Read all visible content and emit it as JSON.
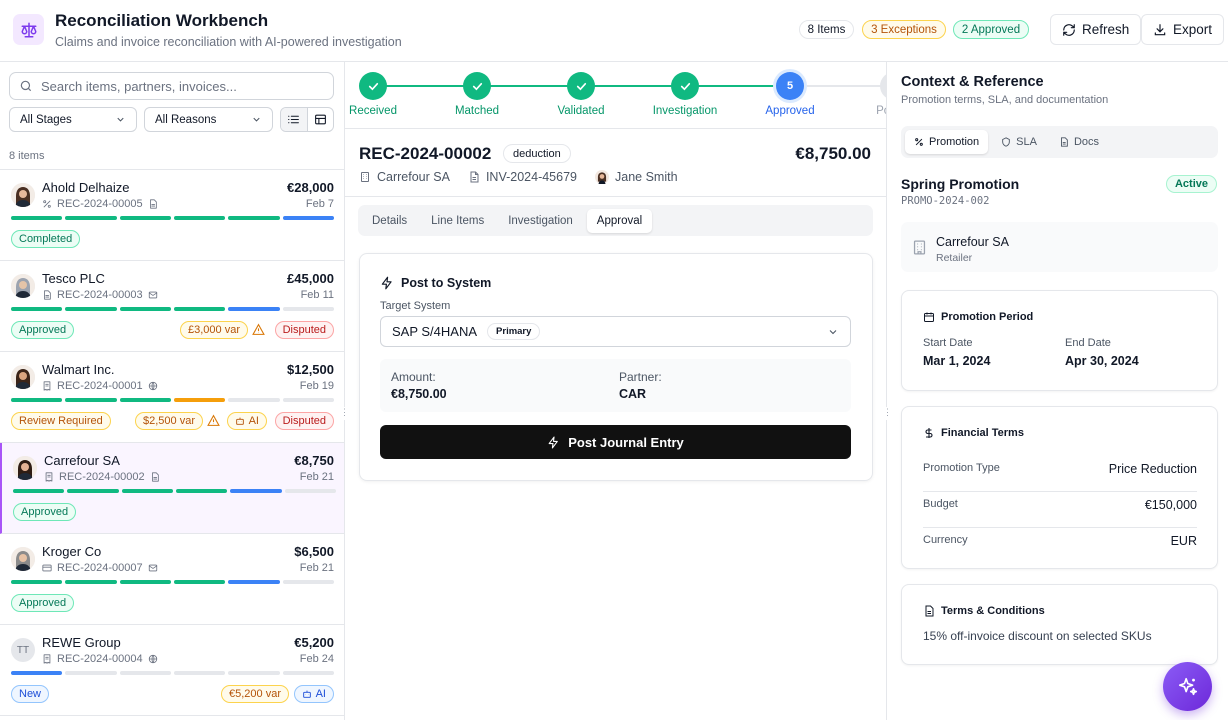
{
  "app": {
    "title": "Reconciliation Workbench",
    "subtitle": "Claims and invoice reconciliation with AI-powered investigation",
    "badges": {
      "items": "8 Items",
      "exceptions": "3 Exceptions",
      "approved": "2 Approved"
    },
    "refresh_label": "Refresh",
    "export_label": "Export"
  },
  "filters": {
    "search_placeholder": "Search items, partners, invoices...",
    "stage": "All Stages",
    "reason": "All Reasons",
    "count_label": "8 items"
  },
  "items": [
    {
      "name": "Ahold Delhaize",
      "amount": "€28,000",
      "ref": "REC-2024-00005",
      "date": "Feb 7",
      "type_icon": "percent-icon",
      "channel_icon": "document-icon",
      "avatar": "photo",
      "bars": [
        "green",
        "green",
        "green",
        "green",
        "green",
        "blue"
      ],
      "status": "Completed",
      "status_color": "green",
      "var": "",
      "flag": "",
      "ai": ""
    },
    {
      "name": "Tesco PLC",
      "amount": "£45,000",
      "ref": "REC-2024-00003",
      "date": "Feb 11",
      "type_icon": "document-icon",
      "channel_icon": "mail-icon",
      "avatar": "photo",
      "bars": [
        "green",
        "green",
        "green",
        "green",
        "blue",
        "gray"
      ],
      "status": "Approved",
      "status_color": "green",
      "var": "£3,000 var",
      "flag": "Disputed",
      "ai": ""
    },
    {
      "name": "Walmart Inc.",
      "amount": "$12,500",
      "ref": "REC-2024-00001",
      "date": "Feb 19",
      "type_icon": "receipt-icon",
      "channel_icon": "globe-icon",
      "avatar": "photo",
      "bars": [
        "green",
        "green",
        "green",
        "orange",
        "gray",
        "gray"
      ],
      "status": "Review Required",
      "status_color": "orange",
      "var": "$2,500 var",
      "flag": "Disputed",
      "ai": "AI"
    },
    {
      "name": "Carrefour SA",
      "amount": "€8,750",
      "ref": "REC-2024-00002",
      "date": "Feb 21",
      "type_icon": "receipt-icon",
      "channel_icon": "document-icon",
      "avatar": "photo",
      "bars": [
        "green",
        "green",
        "green",
        "green",
        "blue",
        "gray"
      ],
      "status": "Approved",
      "status_color": "green",
      "var": "",
      "flag": "",
      "ai": ""
    },
    {
      "name": "Kroger Co",
      "amount": "$6,500",
      "ref": "REC-2024-00007",
      "date": "Feb 21",
      "type_icon": "card-icon",
      "channel_icon": "mail-icon",
      "avatar": "photo",
      "bars": [
        "green",
        "green",
        "green",
        "green",
        "blue",
        "gray"
      ],
      "status": "Approved",
      "status_color": "green",
      "var": "",
      "flag": "",
      "ai": ""
    },
    {
      "name": "REWE Group",
      "amount": "€5,200",
      "ref": "REC-2024-00004",
      "date": "Feb 24",
      "type_icon": "receipt-icon",
      "channel_icon": "globe-icon",
      "avatar": "TT",
      "bars": [
        "blue",
        "gray",
        "gray",
        "gray",
        "gray",
        "gray"
      ],
      "status": "New",
      "status_color": "blue",
      "var": "€5,200 var",
      "flag": "",
      "ai": "AI"
    }
  ],
  "stepper": {
    "steps": [
      {
        "label": "Received",
        "state": "done"
      },
      {
        "label": "Matched",
        "state": "done"
      },
      {
        "label": "Validated",
        "state": "done"
      },
      {
        "label": "Investigation",
        "state": "done"
      },
      {
        "label": "Approved",
        "state": "current",
        "number": "5"
      },
      {
        "label": "Posted",
        "state": "todo"
      }
    ]
  },
  "record": {
    "id": "REC-2024-00002",
    "type": "deduction",
    "amount": "€8,750.00",
    "partner": "Carrefour SA",
    "invoice": "INV-2024-45679",
    "owner": "Jane Smith",
    "tabs": [
      "Details",
      "Line Items",
      "Investigation",
      "Approval"
    ],
    "active_tab": "Approval"
  },
  "post": {
    "title": "Post to System",
    "target_label": "Target System",
    "target_value": "SAP S/4HANA",
    "target_tag": "Primary",
    "amount_label": "Amount:",
    "amount_value": "€8,750.00",
    "partner_label": "Partner:",
    "partner_value": "CAR",
    "button": "Post Journal Entry"
  },
  "context": {
    "title": "Context & Reference",
    "subtitle": "Promotion terms, SLA, and documentation",
    "tabs": [
      "Promotion",
      "SLA",
      "Docs"
    ],
    "promotion": {
      "name": "Spring Promotion",
      "id": "PROMO-2024-002",
      "status": "Active",
      "retailer": "Carrefour SA",
      "retailer_role": "Retailer",
      "period_title": "Promotion Period",
      "start_label": "Start Date",
      "start": "Mar 1, 2024",
      "end_label": "End Date",
      "end": "Apr 30, 2024",
      "financial_title": "Financial Terms",
      "financial": [
        {
          "k": "Promotion Type",
          "v": "Price Reduction"
        },
        {
          "k": "Budget",
          "v": "€150,000"
        },
        {
          "k": "Currency",
          "v": "EUR"
        }
      ],
      "terms_title": "Terms & Conditions",
      "terms": "15% off-invoice discount on selected SKUs"
    }
  },
  "colors": {
    "green": "#10b981",
    "blue": "#3b82f6",
    "orange": "#f59e0b",
    "gray": "#e5e7eb",
    "purple": "#7c3aed"
  }
}
